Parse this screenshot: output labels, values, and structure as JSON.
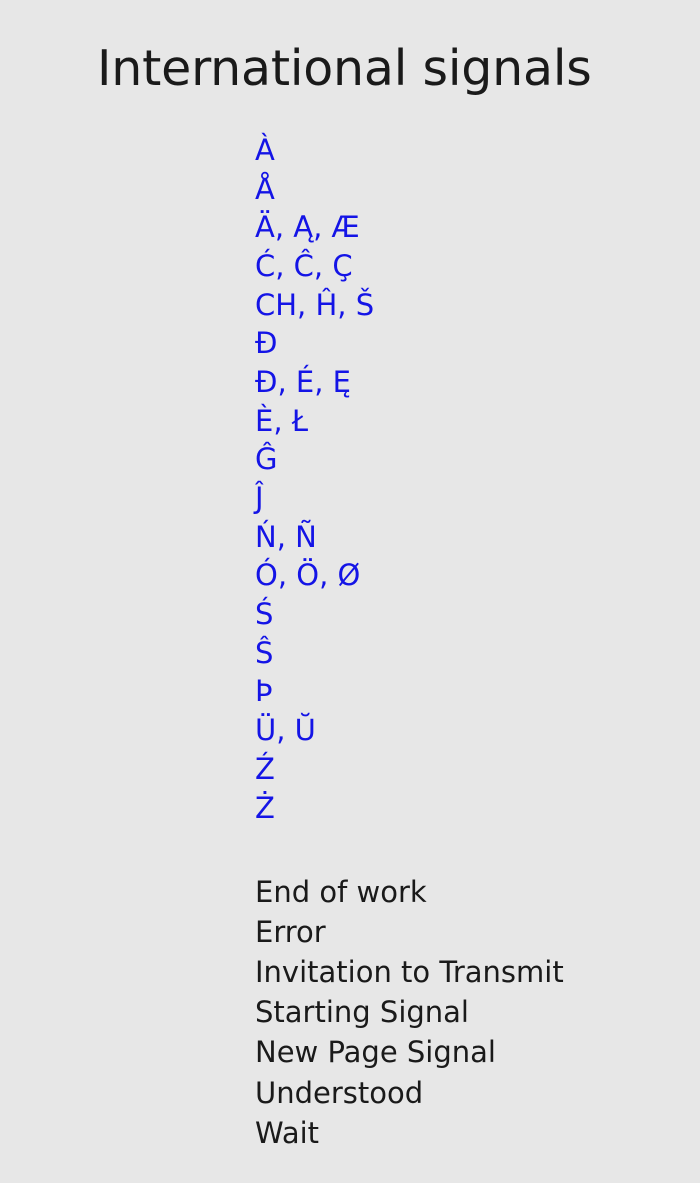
{
  "page": {
    "title": "International signals",
    "background_color": "#e7e7e7",
    "letter_color": "#1414e6",
    "signal_color": "#1a1a1a",
    "morse_color": "#101010"
  },
  "letters_section": {
    "rows": [
      {
        "code": "•———•—",
        "label": "À"
      },
      {
        "code": "•———•—",
        "label": "Å"
      },
      {
        "code": "•—•—",
        "label": "Ä, Ą, Æ"
      },
      {
        "code": "—•—••",
        "label": "Ć, Ĉ, Ç"
      },
      {
        "code": "————",
        "label": "CH, Ĥ, Š"
      },
      {
        "code": "••——•",
        "label": "Đ"
      },
      {
        "code": "••—••",
        "label": "Ð, É, Ę"
      },
      {
        "code": "•—••—",
        "label": "È, Ł"
      },
      {
        "code": "——•—•",
        "label": "Ĝ"
      },
      {
        "code": "•———•",
        "label": "Ĵ"
      },
      {
        "code": "——•——",
        "label": "Ń, Ñ"
      },
      {
        "code": "———•",
        "label": "Ó, Ö, Ø"
      },
      {
        "code": "•••—•••",
        "label": "Ś"
      },
      {
        "code": "•••—•",
        "label": "Ŝ"
      },
      {
        "code": "•——••",
        "label": "Þ"
      },
      {
        "code": "••——",
        "label": "Ü, Ŭ"
      },
      {
        "code": "——••—•",
        "label": "Ź"
      },
      {
        "code": "——••—",
        "label": "Ż"
      }
    ]
  },
  "signals_section": {
    "rows": [
      {
        "code": "•••—•—",
        "label": "End of work"
      },
      {
        "code": "••••••••",
        "label": "Error"
      },
      {
        "code": "—•—",
        "label": "Invitation to Transmit"
      },
      {
        "code": "—•—•—",
        "label": "Starting Signal"
      },
      {
        "code": "•—•—•",
        "label": "New Page Signal"
      },
      {
        "code": "•••—•",
        "label": "Understood"
      },
      {
        "code": "•—•••",
        "label": "Wait"
      }
    ]
  }
}
